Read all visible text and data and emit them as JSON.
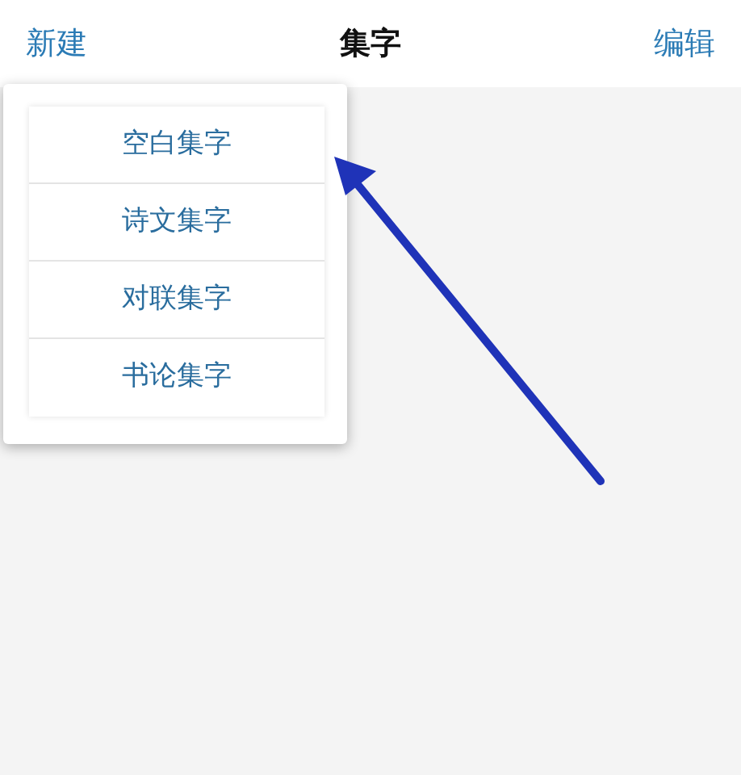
{
  "navbar": {
    "left_button": "新建",
    "title": "集字",
    "right_button": "编辑"
  },
  "popover_menu": {
    "items": [
      "空白集字",
      "诗文集字",
      "对联集字",
      "书论集字"
    ]
  }
}
